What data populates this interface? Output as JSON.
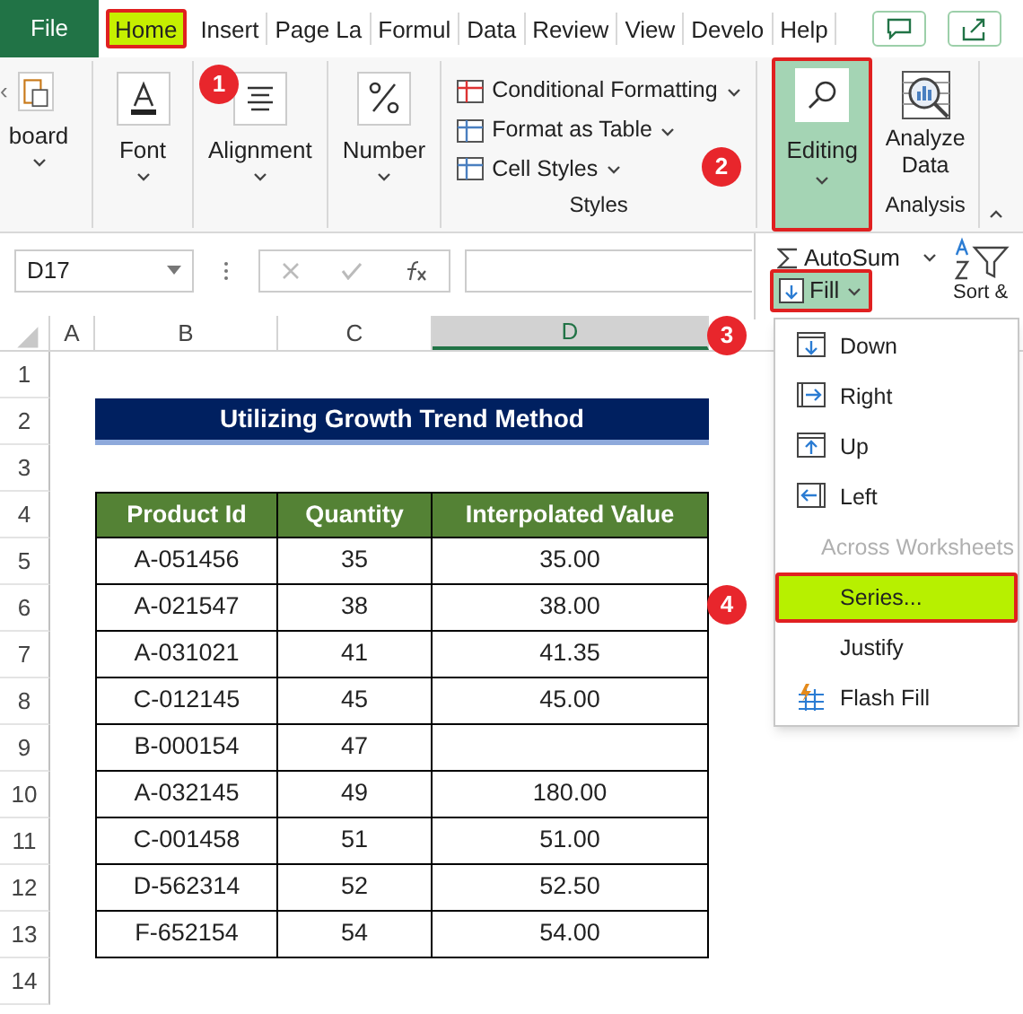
{
  "tabs": [
    {
      "label": "File",
      "kind": "file",
      "selected": false
    },
    {
      "label": "Home",
      "kind": "tab",
      "selected": true
    },
    {
      "label": "Insert",
      "kind": "tab",
      "selected": false
    },
    {
      "label": "Page La",
      "kind": "tab",
      "selected": false
    },
    {
      "label": "Formul",
      "kind": "tab",
      "selected": false
    },
    {
      "label": "Data",
      "kind": "tab",
      "selected": false
    },
    {
      "label": "Review",
      "kind": "tab",
      "selected": false
    },
    {
      "label": "View",
      "kind": "tab",
      "selected": false
    },
    {
      "label": "Develo",
      "kind": "tab",
      "selected": false
    },
    {
      "label": "Help",
      "kind": "tab",
      "selected": false
    }
  ],
  "ribbon": {
    "scroll_left": "‹",
    "groups": [
      {
        "kind": "big",
        "label": "board"
      },
      {
        "kind": "big",
        "label": "Font"
      },
      {
        "kind": "big",
        "label": "Alignment"
      },
      {
        "kind": "big",
        "label": "Number"
      },
      {
        "kind": "styles",
        "label": "Styles",
        "items": [
          "Conditional Formatting",
          "Format as Table",
          "Cell Styles"
        ]
      },
      {
        "kind": "editing",
        "label": "Editing",
        "selected": true
      },
      {
        "kind": "analysis",
        "button": "Analyze Data",
        "label": "Analysis"
      }
    ]
  },
  "formula_bar": {
    "name_box": "D17"
  },
  "editing_panel": {
    "autosum": "AutoSum",
    "sort": "Sort &",
    "fill": {
      "label": "Fill",
      "selected": true
    }
  },
  "fill_menu": [
    {
      "label": "Down",
      "disabled": false,
      "selected": false
    },
    {
      "label": "Right",
      "disabled": false,
      "selected": false
    },
    {
      "label": "Up",
      "disabled": false,
      "selected": false
    },
    {
      "label": "Left",
      "disabled": false,
      "selected": false
    },
    {
      "label": "Across Worksheets",
      "disabled": true,
      "selected": false
    },
    {
      "label": "Series...",
      "disabled": false,
      "selected": true
    },
    {
      "label": "Justify",
      "disabled": false,
      "selected": false
    },
    {
      "label": "Flash Fill",
      "disabled": false,
      "selected": false
    }
  ],
  "sheet": {
    "columns": [
      {
        "label": "A",
        "selected": false
      },
      {
        "label": "B",
        "selected": false
      },
      {
        "label": "C",
        "selected": false
      },
      {
        "label": "D",
        "selected": true
      }
    ],
    "row_numbers": [
      "1",
      "2",
      "3",
      "4",
      "5",
      "6",
      "7",
      "8",
      "9",
      "10",
      "11",
      "12",
      "13",
      "14"
    ],
    "title": "Utilizing Growth Trend Method",
    "table": {
      "columns": [
        "Product Id",
        "Quantity",
        "Interpolated Value"
      ],
      "rows": [
        [
          "A-051456",
          "35",
          "35.00"
        ],
        [
          "A-021547",
          "38",
          "38.00"
        ],
        [
          "A-031021",
          "41",
          "41.35"
        ],
        [
          "C-012145",
          "45",
          "45.00"
        ],
        [
          "B-000154",
          "47",
          null
        ],
        [
          "A-032145",
          "49",
          "180.00"
        ],
        [
          "C-001458",
          "51",
          "51.00"
        ],
        [
          "D-562314",
          "52",
          "52.50"
        ],
        [
          "F-652154",
          "54",
          "54.00"
        ]
      ]
    }
  },
  "callouts": [
    "1",
    "2",
    "3",
    "4"
  ]
}
